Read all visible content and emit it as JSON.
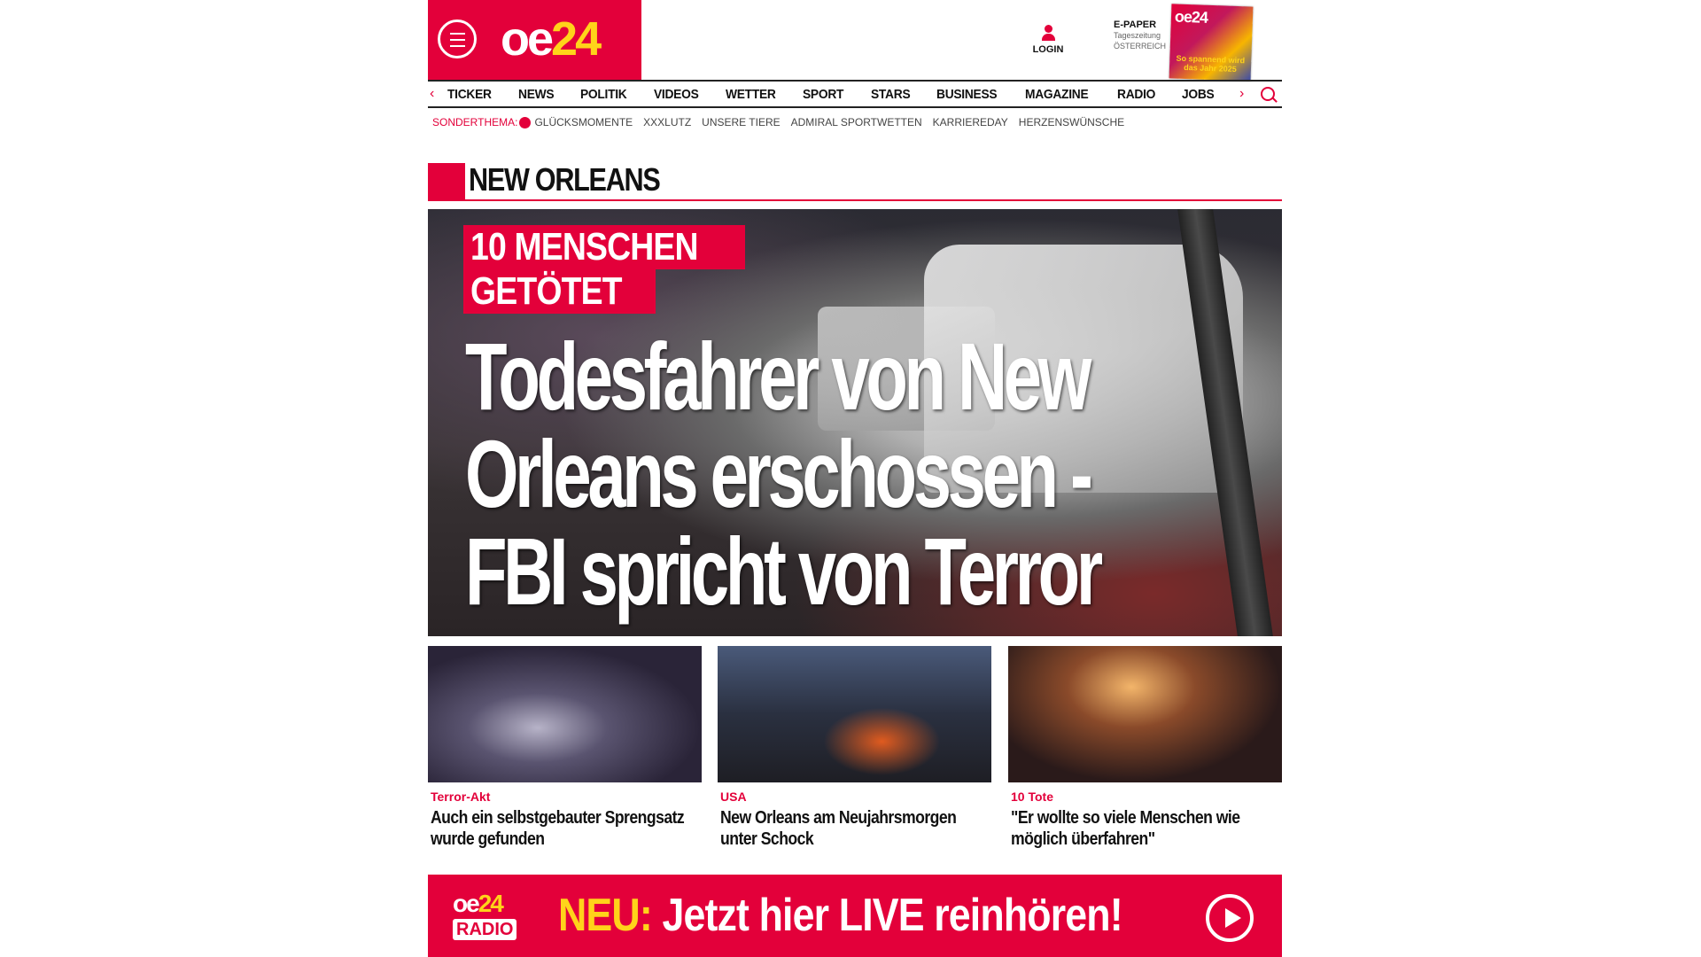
{
  "header": {
    "logo_main": "oe",
    "logo_num": "24",
    "login_label": "LOGIN",
    "epaper_title": "E-PAPER",
    "epaper_sub1": "Tageszeitung",
    "epaper_sub2": "ÖSTERREICH",
    "cover_title": "oe24",
    "cover_headline": "So spannend wird das Jahr 2025"
  },
  "nav": {
    "items": [
      "TICKER",
      "NEWS",
      "POLITIK",
      "VIDEOS",
      "WETTER",
      "SPORT",
      "STARS",
      "BUSINESS",
      "MAGAZINE",
      "RADIO",
      "JOBS"
    ]
  },
  "subnav": {
    "label": "SONDERTHEMA:",
    "items": [
      "GLÜCKSMOMENTE",
      "XXXLUTZ",
      "UNSERE TIERE",
      "ADMIRAL SPORTWETTEN",
      "KARRIEREDAY",
      "HERZENSWÜNSCHE"
    ]
  },
  "section": {
    "title": "NEW ORLEANS"
  },
  "hero": {
    "label_line1": "10 MENSCHEN",
    "label_line2": "GETÖTET",
    "headline": "Todesfahrer von New Orleans erschossen - FBI spricht von Terror"
  },
  "teasers": [
    {
      "kicker": "Terror-Akt",
      "title": "Auch ein selbstgebauter Sprengsatz wurde gefunden"
    },
    {
      "kicker": "USA",
      "title": "New Orleans am Neujahrsmorgen unter Schock"
    },
    {
      "kicker": "10 Tote",
      "title": "\"Er wollte so viele Menschen wie möglich überfahren\""
    }
  ],
  "radio_banner": {
    "logo_main": "oe",
    "logo_num": "24",
    "logo_sub": "RADIO",
    "text_highlight": "NEU:",
    "text_main": "Jetzt hier LIVE reinhören!"
  },
  "colors": {
    "brand_red": "#e3003a",
    "brand_yellow": "#ffd31a"
  }
}
